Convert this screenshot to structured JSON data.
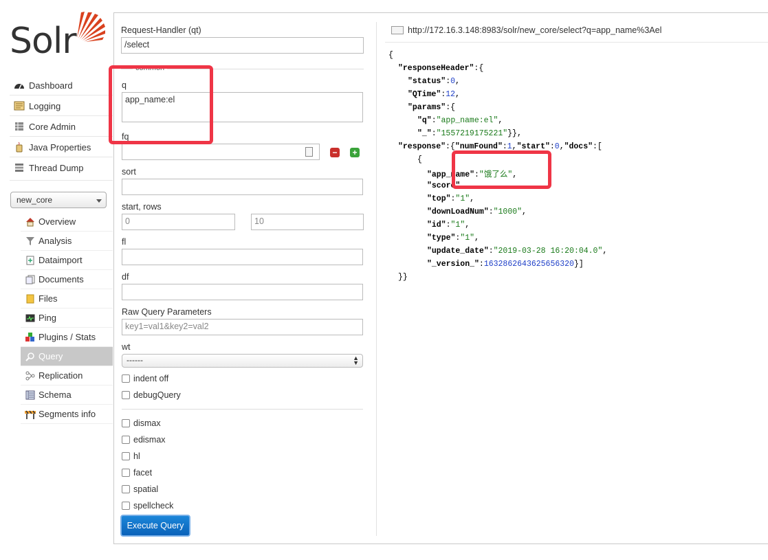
{
  "logo": {
    "text": "Solr"
  },
  "nav": {
    "items": [
      {
        "label": "Dashboard",
        "icon": "dashboard-icon"
      },
      {
        "label": "Logging",
        "icon": "logging-icon"
      },
      {
        "label": "Core Admin",
        "icon": "core-admin-icon"
      },
      {
        "label": "Java Properties",
        "icon": "java-icon"
      },
      {
        "label": "Thread Dump",
        "icon": "thread-dump-icon"
      }
    ],
    "core_selector": "new_core",
    "core_items": [
      {
        "label": "Overview",
        "icon": "home-icon"
      },
      {
        "label": "Analysis",
        "icon": "funnel-icon"
      },
      {
        "label": "Dataimport",
        "icon": "import-icon"
      },
      {
        "label": "Documents",
        "icon": "documents-icon"
      },
      {
        "label": "Files",
        "icon": "folder-icon"
      },
      {
        "label": "Ping",
        "icon": "ping-icon"
      },
      {
        "label": "Plugins / Stats",
        "icon": "plugins-icon"
      },
      {
        "label": "Query",
        "icon": "magnifier-icon",
        "active": true
      },
      {
        "label": "Replication",
        "icon": "replication-icon"
      },
      {
        "label": "Schema",
        "icon": "schema-icon"
      },
      {
        "label": "Segments info",
        "icon": "segments-icon"
      }
    ]
  },
  "form": {
    "qt_label": "Request-Handler (qt)",
    "qt_value": "/select",
    "common_legend": "common",
    "q_label": "q",
    "q_value": "app_name:el",
    "fq_label": "fq",
    "fq_value": "",
    "sort_label": "sort",
    "sort_value": "",
    "start_rows_label": "start, rows",
    "start_value": "0",
    "rows_value": "10",
    "fl_label": "fl",
    "fl_value": "",
    "df_label": "df",
    "df_value": "",
    "raw_label": "Raw Query Parameters",
    "raw_placeholder": "key1=val1&key2=val2",
    "wt_label": "wt",
    "wt_value": "------",
    "indent_label": "indent off",
    "debug_label": "debugQuery",
    "options": [
      "dismax",
      "edismax",
      "hl",
      "facet",
      "spatial",
      "spellcheck"
    ],
    "execute_label": "Execute Query"
  },
  "result": {
    "url": "http://172.16.3.148:8983/solr/new_core/select?q=app_name%3Ael",
    "lines": {
      "l0": "{",
      "responseHeader": "\"responseHeader\"",
      "status_k": "\"status\"",
      "status_v": "0",
      "qtime_k": "\"QTime\"",
      "qtime_v": "12",
      "params_k": "\"params\"",
      "q_k": "\"q\"",
      "q_v": "\"app_name:el\"",
      "under_k": "\"_\"",
      "under_v": "\"1557219175221\"",
      "response_k": "\"response\"",
      "numfound_k": "\"numFound\"",
      "numfound_v": "1",
      "start_k": "\"start\"",
      "start_v": "0",
      "docs_k": "\"docs\"",
      "appname_k": "\"app_name\"",
      "appname_v": "\"饿了么\"",
      "score_k": "\"score\"",
      "top_k": "\"top\"",
      "top_v": "\"1\"",
      "download_k": "\"downLoadNum\"",
      "download_v": "\"1000\"",
      "id_k": "\"id\"",
      "id_v": "\"1\"",
      "type_k": "\"type\"",
      "type_v": "\"1\"",
      "update_k": "\"update_date\"",
      "update_v": "\"2019-03-28 16:20:04.0\"",
      "version_k": "\"_version_\"",
      "version_v": "1632862643625656320"
    }
  },
  "colors": {
    "accent": "#0a62b9",
    "highlight": "#ef3546",
    "string": "#1a7a1a",
    "number": "#1e3fc8"
  }
}
